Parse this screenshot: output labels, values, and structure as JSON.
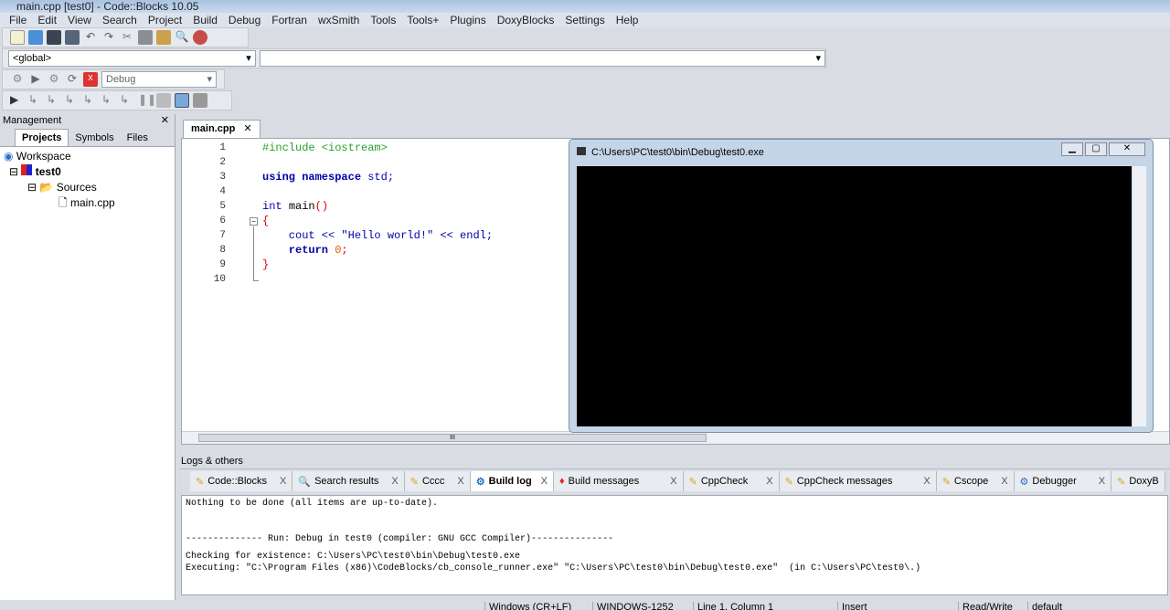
{
  "window": {
    "title": "main.cpp [test0] - Code::Blocks 10.05"
  },
  "menu": [
    "File",
    "Edit",
    "View",
    "Search",
    "Project",
    "Build",
    "Debug",
    "Fortran",
    "wxSmith",
    "Tools",
    "Tools+",
    "Plugins",
    "DoxyBlocks",
    "Settings",
    "Help"
  ],
  "toolbar": {
    "scope_select": "<global>",
    "symbol_select": "",
    "build_target": "Debug"
  },
  "management": {
    "title": "Management",
    "tabs": [
      "Projects",
      "Symbols",
      "Files"
    ],
    "active_tab": "Projects",
    "tree": {
      "workspace": "Workspace",
      "project": "test0",
      "folder": "Sources",
      "file": "main.cpp"
    }
  },
  "editor": {
    "tab": "main.cpp",
    "lines": [
      "1",
      "2",
      "3",
      "4",
      "5",
      "6",
      "7",
      "8",
      "9",
      "10"
    ],
    "code": {
      "l1": "#include <iostream>",
      "l3a": "using namespace ",
      "l3b": "std;",
      "l5a": "int ",
      "l5b": "main",
      "l5c": "()",
      "l6": "{",
      "l7a": "    cout << ",
      "l7b": "\"Hello world!\"",
      "l7c": " << endl;",
      "l8a": "    return ",
      "l8b": "0",
      "l8c": ";",
      "l9": "}"
    },
    "scroll_thumb": "III"
  },
  "console": {
    "title": "C:\\Users\\PC\\test0\\bin\\Debug\\test0.exe"
  },
  "logs": {
    "title": "Logs & others",
    "tabs": [
      {
        "label": "Code::Blocks",
        "icon": "pencil-icon"
      },
      {
        "label": "Search results",
        "icon": "search-icon"
      },
      {
        "label": "Cccc",
        "icon": "pencil-icon"
      },
      {
        "label": "Build log",
        "icon": "gear-icon"
      },
      {
        "label": "Build messages",
        "icon": "pin-icon"
      },
      {
        "label": "CppCheck",
        "icon": "pencil-icon"
      },
      {
        "label": "CppCheck messages",
        "icon": "pencil-icon"
      },
      {
        "label": "Cscope",
        "icon": "pencil-icon"
      },
      {
        "label": "Debugger",
        "icon": "gear-icon"
      },
      {
        "label": "DoxyB",
        "icon": "pencil-icon"
      }
    ],
    "active_tab": "Build log",
    "lines": [
      "Nothing to be done (all items are up-to-date).",
      "-------------- Run: Debug in test0 (compiler: GNU GCC Compiler)---------------",
      "Checking for existence: C:\\Users\\PC\\test0\\bin\\Debug\\test0.exe",
      "Executing: \"C:\\Program Files (x86)\\CodeBlocks/cb_console_runner.exe\" \"C:\\Users\\PC\\test0\\bin\\Debug\\test0.exe\"  (in C:\\Users\\PC\\test0\\.)"
    ]
  },
  "status": {
    "eol": "Windows (CR+LF)",
    "encoding": "WINDOWS-1252",
    "position": "Line 1, Column 1",
    "mode": "Insert",
    "access": "Read/Write",
    "profile": "default"
  }
}
